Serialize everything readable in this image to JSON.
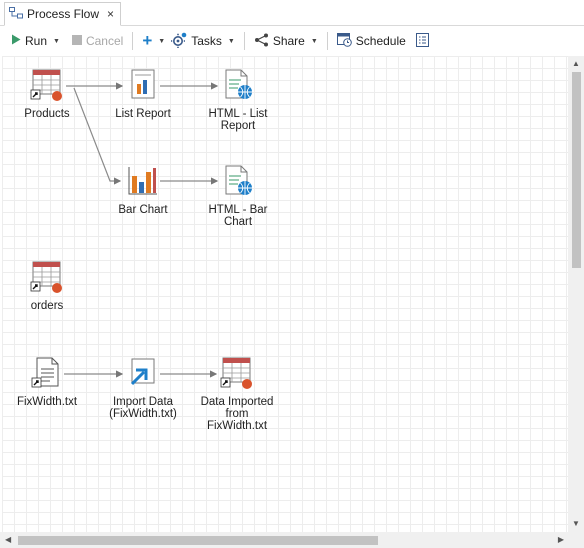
{
  "tab": {
    "title": "Process Flow",
    "close": "×",
    "icon": "process-flow-icon"
  },
  "toolbar": {
    "run": "Run",
    "cancel": "Cancel",
    "add": "+",
    "tasks": "Tasks",
    "share": "Share",
    "schedule": "Schedule"
  },
  "nodes": {
    "products": "Products",
    "list_report": "List Report",
    "html_list_report_1": "HTML - List",
    "html_list_report_2": "Report",
    "bar_chart": "Bar Chart",
    "html_bar_chart_1": "HTML - Bar",
    "html_bar_chart_2": "Chart",
    "orders": "orders",
    "fixwidth": "FixWidth.txt",
    "import_data_1": "Import Data",
    "import_data_2": "(FixWidth.txt)",
    "data_imported_1": "Data Imported",
    "data_imported_2": "from",
    "data_imported_3": "FixWidth.txt"
  },
  "colors": {
    "accent": "#1e7fc9",
    "table_header": "#c0504d",
    "shortcut_dot": "#d9532c",
    "bar_orange": "#e07b22",
    "bar_blue": "#2f6db3"
  }
}
